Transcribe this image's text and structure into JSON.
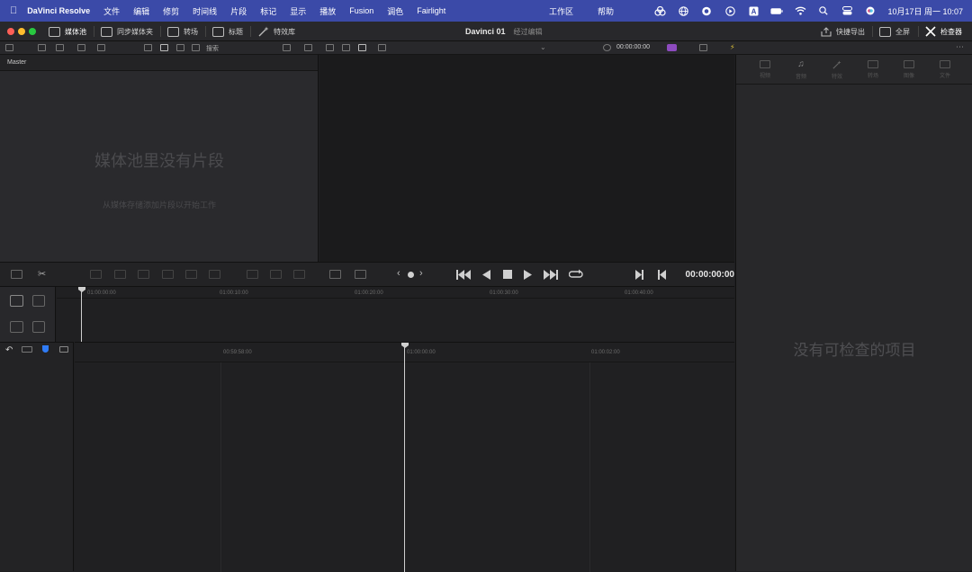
{
  "menubar": {
    "app_name": "DaVinci Resolve",
    "items": [
      "文件",
      "编辑",
      "修剪",
      "时间线",
      "片段",
      "标记",
      "显示",
      "播放",
      "Fusion",
      "调色",
      "Fairlight"
    ],
    "center_items": [
      "工作区",
      "帮助"
    ],
    "clock": "10月17日 周一  10:07",
    "status_letter": "A"
  },
  "toolbar": {
    "media_pool": "媒体池",
    "sync_bin": "同步媒体夹",
    "transitions": "转场",
    "titles": "标题",
    "effects": "特效库",
    "project_name": "Davinci 01",
    "project_state": "经过编辑",
    "quick_export": "快捷导出",
    "fullscreen": "全屏",
    "inspector": "检查器"
  },
  "subbar": {
    "search_placeholder": "搜索",
    "timecode": "00:00:00:00"
  },
  "media_pool": {
    "bin_name": "Master",
    "empty_title": "媒体池里没有片段",
    "empty_hint": "从媒体存储添加片段以开始工作"
  },
  "inspector": {
    "tabs": [
      {
        "label": "视频",
        "icon": "video-icon"
      },
      {
        "label": "音频",
        "icon": "music-note-icon"
      },
      {
        "label": "特效",
        "icon": "effects-wand-icon"
      },
      {
        "label": "转场",
        "icon": "transition-icon"
      },
      {
        "label": "图像",
        "icon": "image-icon"
      },
      {
        "label": "文件",
        "icon": "file-icon"
      }
    ],
    "empty_message": "没有可检查的项目"
  },
  "transport": {
    "timecode": "00:00:00:00"
  },
  "timeline_upper": {
    "ruler_labels": [
      "01:00:00:00",
      "01:00:10:00",
      "01:00:20:00",
      "01:00:30:00",
      "01:00:40:00"
    ]
  },
  "timeline_lower": {
    "ruler_labels": [
      "00:59:58:00",
      "01:00:00:00",
      "01:00:02:00"
    ]
  },
  "colors": {
    "menubar_bg": "#3b4aa8",
    "accent_blue": "#2f7bf5",
    "traffic_red": "#fe5f57",
    "traffic_yellow": "#febc2e",
    "traffic_green": "#28c840"
  }
}
